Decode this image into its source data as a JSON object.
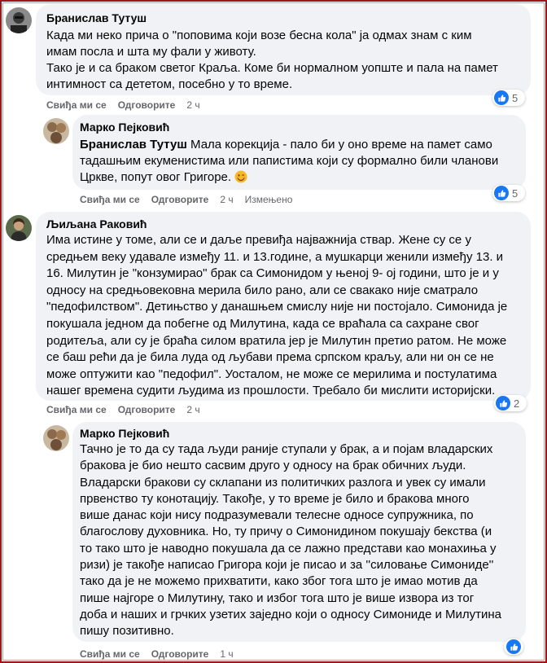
{
  "comments": [
    {
      "author": "Бранислав Тутуш",
      "lines": [
        "Када ми неко прича о \"поповима који возе бесна кола\" ја одмах знам с ким",
        "имам посла и шта му фали у животу.",
        "Тако је и са браком светог Краља. Коме би нормалном уопште и пала на памет",
        "интимност са дететом, посебно у то време."
      ],
      "actions": {
        "like": "Свиђа ми се",
        "reply": "Одговорите",
        "time": "2 ч"
      },
      "reaction_count": "5"
    },
    {
      "author": "Марко Пејковић",
      "mention": "Бранислав Тутуш",
      "lines": [
        "Мала корекција - пало би у оно време на памет само",
        "тадашњим екуменистима или папистима који су формално били чланови",
        "Цркве, попут овог Григоре."
      ],
      "actions": {
        "like": "Свиђа ми се",
        "reply": "Одговорите",
        "time": "2 ч",
        "edited": "Измењено"
      },
      "reaction_count": "5"
    },
    {
      "author": "Љиљана Раковић",
      "lines": [
        "Има истине у томе, али се и даље превиђа најважнија ствар. Жене су се у",
        "средњем веку удавале између 11. и 13.године, а мушкарци женили између 13. и",
        "16. Милутин је \"конзумирао\" брак са Симонидом у њеној 9- ој години, што је и у",
        "односу на средњовековна мерила било рано, али се свакако није сматрало",
        "\"педофилством\". Детињство у данашњем смислу није ни постојало. Симонида је",
        "покушала једном да побегне од Милутина, када се враћала са сахране свог",
        "родитеља, али су је браћа силом вратила јер је Милутин претио ратом. Не може",
        "се баш рећи да је била луда од љубави према српском краљу, али ни он се не",
        "може оптужити као \"педофил\". Уосталом, не може се мерилима и постулатима",
        "нашег времена судити људима из прошлости. Требало би мислити историјски."
      ],
      "actions": {
        "like": "Свиђа ми се",
        "reply": "Одговорите",
        "time": "2 ч"
      },
      "reaction_count": "2"
    },
    {
      "author": "Марко Пејковић",
      "lines": [
        "Тачно је то да су тада људи раније ступали у брак, а и појам владарских",
        "бракова је био нешто сасвим друго у односу на брак обичних људи.",
        "Владарски бракови су склапани из политичких разлога и увек су имали",
        "првенство ту конотацију. Такође, у то време је било и бракова много",
        "више данас који нису подразумевали телесне односе супружника, по",
        "благослову духовника. Но, ту причу о Симонидином покушају бекства (и",
        "то тако што је наводно покушала да се лажно представи као монахиња у",
        "ризи) је такође написао Григора који је писао и за ''силовање Симониде''",
        "тако да је не можемо прихватити, како због тога што је имао мотив да",
        "пише најгоре о Милутину, тако и избог тога што је више извора из тог",
        "доба и наших и грчких узетих заједно који о односу Симониде и Милутина",
        "пишу позитивно."
      ],
      "actions": {
        "like": "Свиђа ми се",
        "reply": "Одговорите",
        "time": "1 ч"
      }
    }
  ],
  "colors": {
    "like_blue": "#1877f2",
    "bubble": "#f0f2f5",
    "frame": "#9a1818"
  },
  "icons": {
    "reaction": "like-icon",
    "emoji": "smiling-face-icon"
  }
}
